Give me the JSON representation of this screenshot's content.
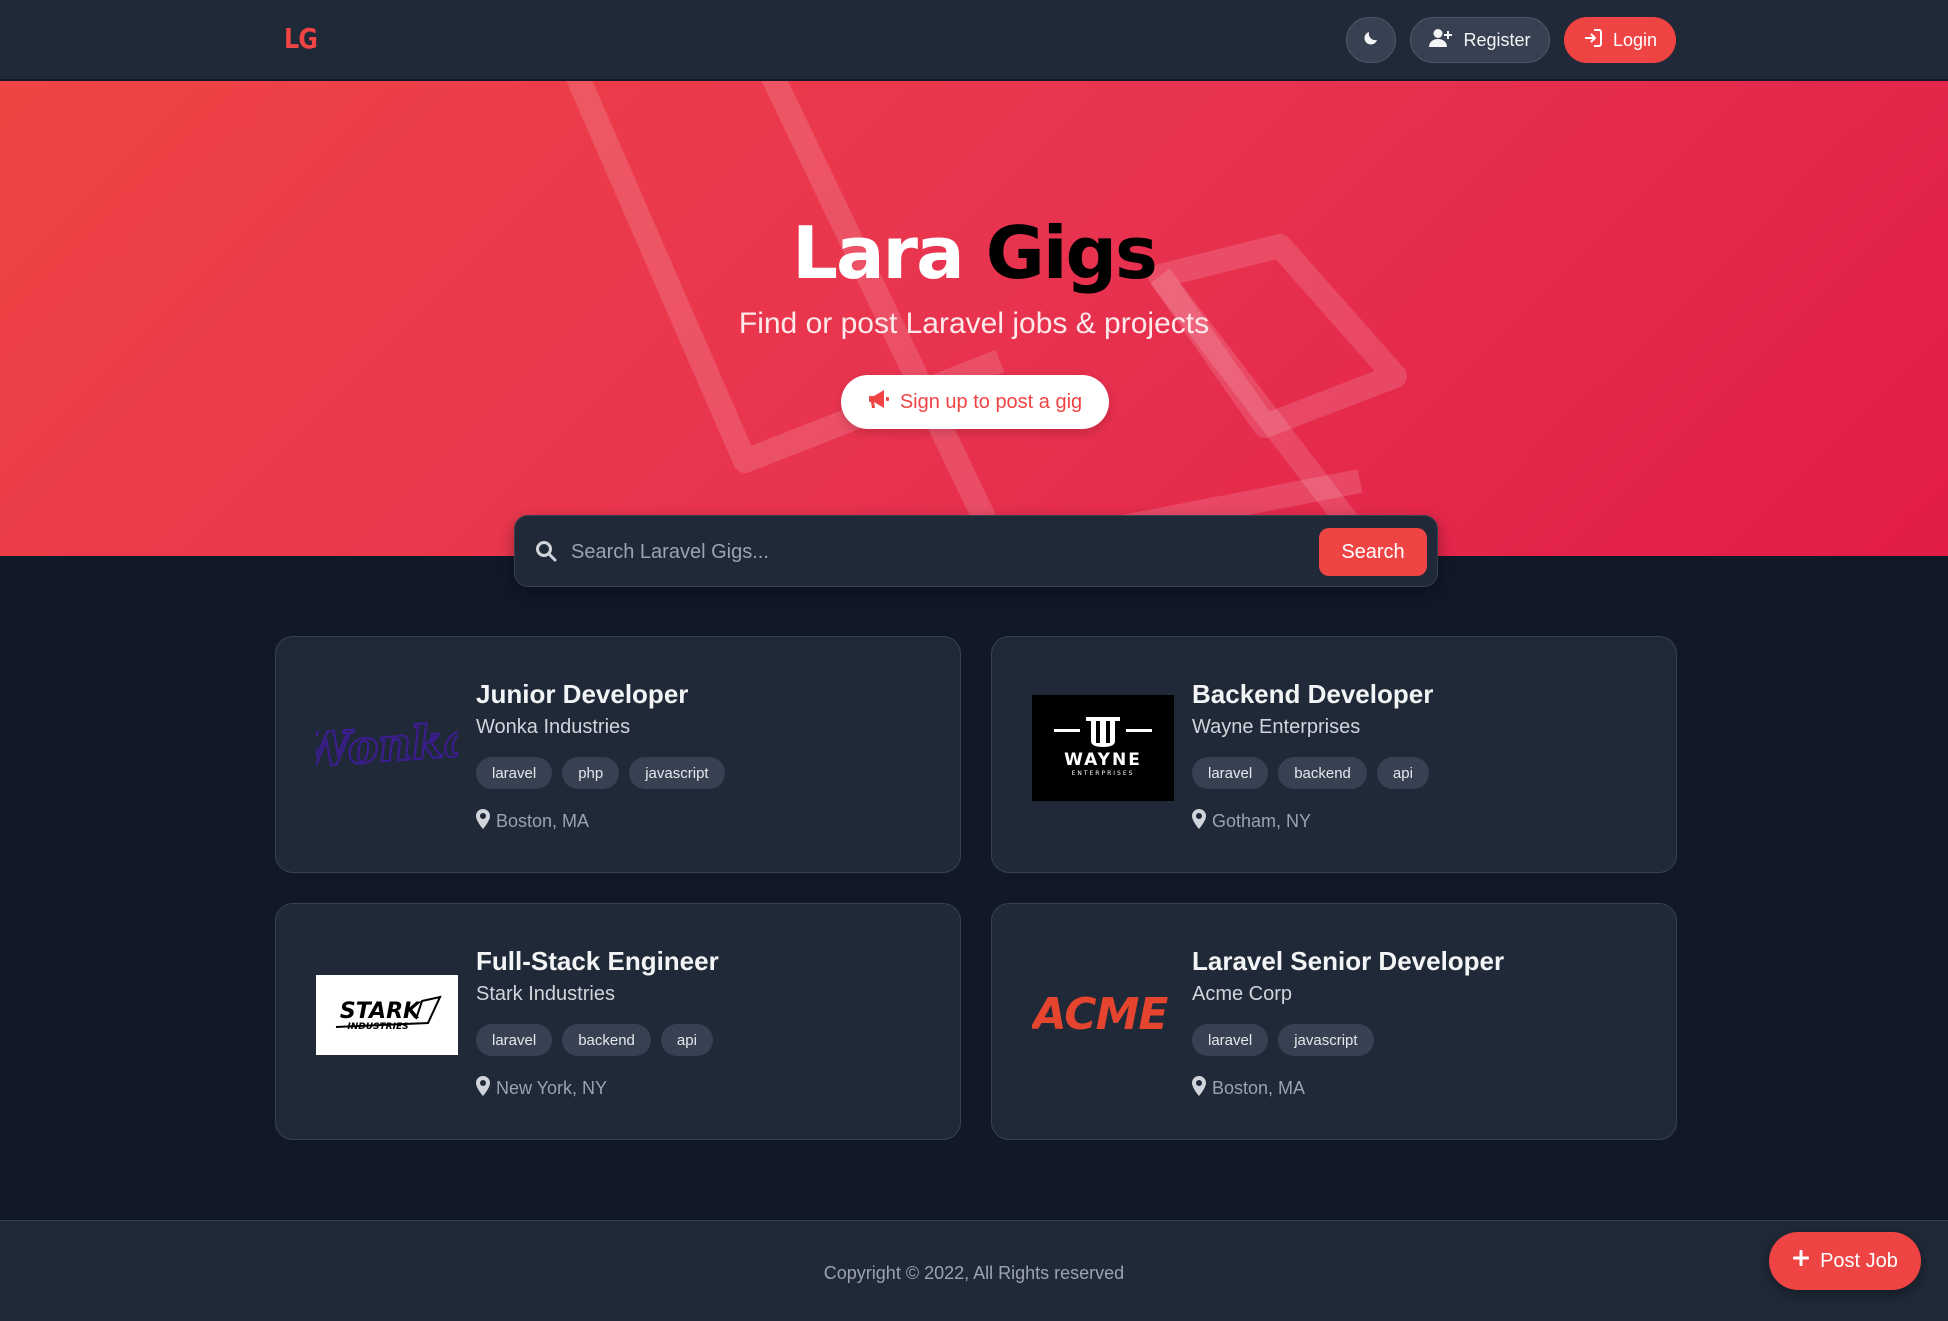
{
  "nav": {
    "logo": "LG",
    "register_label": "Register",
    "login_label": "Login"
  },
  "hero": {
    "title_part1": "Lara",
    "title_part2": "Gigs",
    "subtitle": "Find or post Laravel jobs & projects",
    "cta_label": "Sign up to post a gig"
  },
  "search": {
    "placeholder": "Search Laravel Gigs...",
    "value": "",
    "button_label": "Search"
  },
  "listings": [
    {
      "title": "Junior Developer",
      "company": "Wonka Industries",
      "logo_text": "Wonka",
      "tags": [
        "laravel",
        "php",
        "javascript"
      ],
      "location": "Boston, MA"
    },
    {
      "title": "Backend Developer",
      "company": "Wayne Enterprises",
      "logo_text": "WAYNE",
      "logo_subtext": "ENTERPRISES",
      "tags": [
        "laravel",
        "backend",
        "api"
      ],
      "location": "Gotham, NY"
    },
    {
      "title": "Full-Stack Engineer",
      "company": "Stark Industries",
      "logo_text": "STARK",
      "logo_subtext": "INDUSTRIES",
      "tags": [
        "laravel",
        "backend",
        "api"
      ],
      "location": "New York, NY"
    },
    {
      "title": "Laravel Senior Developer",
      "company": "Acme Corp",
      "logo_text": "ACME",
      "tags": [
        "laravel",
        "javascript"
      ],
      "location": "Boston, MA"
    }
  ],
  "footer": {
    "copyright": "Copyright © 2022, All Rights reserved"
  },
  "fab": {
    "label": "Post Job"
  },
  "colors": {
    "accent": "#ef4444",
    "background": "#111827",
    "surface": "#1f2937"
  }
}
